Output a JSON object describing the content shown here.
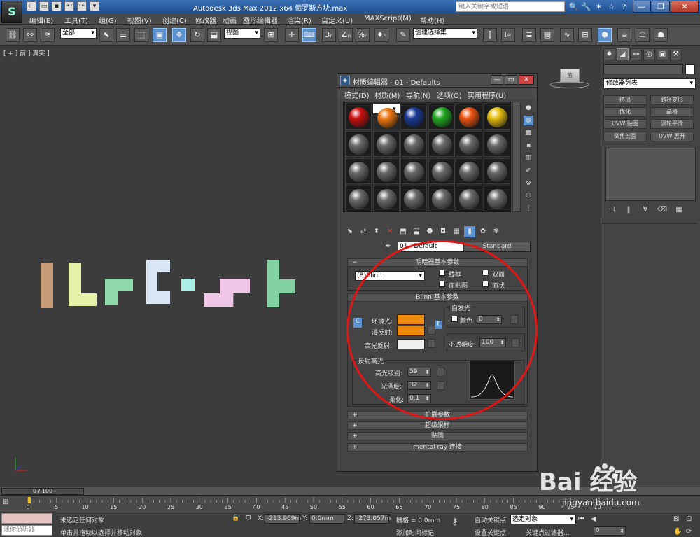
{
  "title_bar": {
    "logo": "S",
    "window_title": "Autodesk 3ds Max  2012 x64   俄罗斯方块.max",
    "search_placeholder": "键入关键字或短语",
    "title_icons": [
      "🔍",
      "🔧",
      "✶",
      "☆",
      "?"
    ],
    "controls": [
      "—",
      "❐",
      "✕"
    ]
  },
  "menu": [
    "编辑(E)",
    "工具(T)",
    "组(G)",
    "视图(V)",
    "创建(C)",
    "修改器",
    "动画",
    "图形编辑器",
    "渲染(R)",
    "自定义(U)",
    "MAXScript(M)",
    "帮助(H)"
  ],
  "toolbar": {
    "filter_select": "全部",
    "view_select": "视图",
    "selection_set": "创建选择集",
    "snap_labels": [
      "3ₙ",
      "∠ₙ",
      "%ₙ",
      "♦ₙ"
    ]
  },
  "viewport": {
    "label": "[ + ] 前 ] 真实 ]",
    "viewcube_label": "前",
    "blocks": [
      {
        "color": "#c49a77"
      },
      {
        "color": "#e6f0a6"
      },
      {
        "color": "#8ed8a9"
      },
      {
        "color": "#d9e6f5"
      },
      {
        "color": "#aaf0e6"
      },
      {
        "color": "#f0c6e6"
      },
      {
        "color": "#84d2a4"
      }
    ]
  },
  "material_editor": {
    "title": "材质编辑器 - 01 - Defaults",
    "menu": [
      "模式(D)",
      "材质(M)",
      "导航(N)",
      "选项(O)",
      "实用程序(U)"
    ],
    "sample_colors": [
      "#cc1111",
      "#ee7711",
      "#1a3a99",
      "#22aa22",
      "#ee5511",
      "#e8c012"
    ],
    "material_name": "01 - Default",
    "material_type": "Standard",
    "shader_rollout": "明暗器基本参数",
    "shader_type": "(B)Blinn",
    "shader_options": [
      "线框",
      "双面",
      "面贴图",
      "面状"
    ],
    "blinn_rollout": "Blinn 基本参数",
    "self_illum_group": "自发光",
    "self_illum_color_label": "颜色",
    "self_illum_value": "0",
    "ambient_label": "环境光:",
    "diffuse_label": "漫反射:",
    "specular_label": "高光反射:",
    "ambient_color": "#f08a0a",
    "diffuse_color": "#f08a0a",
    "specular_color": "#f0f0f0",
    "opacity_label": "不透明度:",
    "opacity_value": "100",
    "spec_group": "反射高光",
    "spec_level_label": "高光级别:",
    "spec_level_value": "59",
    "glossiness_label": "光泽度:",
    "glossiness_value": "32",
    "soften_label": "柔化:",
    "soften_value": "0.1",
    "lock_c": "C",
    "map_f": "F",
    "rollouts": [
      "扩展参数",
      "超级采样",
      "贴图",
      "mental ray 连接"
    ]
  },
  "command_panel": {
    "modifier_list": "修改器列表",
    "buttons": [
      "挤出",
      "路径变形",
      "优化",
      "晶格",
      "UVW 贴图",
      "涡轮平滑",
      "倒角剖面",
      "UVW 展开"
    ]
  },
  "timeline": {
    "frame": "0 / 100",
    "ticks": [
      "0",
      "5",
      "10",
      "15",
      "20",
      "25",
      "30",
      "35",
      "40",
      "45",
      "50",
      "55",
      "60",
      "65",
      "70",
      "75",
      "80",
      "85",
      "90",
      "95",
      "100"
    ]
  },
  "status": {
    "script_hint": "迷你侦听器",
    "selection": "未选定任何对象",
    "prompt": "单击并拖动以选择并移动对象",
    "x_label": "X:",
    "x_value": "-213.969m",
    "y_label": "Y:",
    "y_value": "0.0mm",
    "z_label": "Z:",
    "z_value": "-273.057m",
    "grid": "栅格 = 0.0mm",
    "add_time_tag": "添加时间标记",
    "auto_key": "自动关键点",
    "set_key": "设置关键点",
    "selected_obj": "选定对象",
    "key_filter": "关键点过滤器...",
    "frame_value": "0"
  },
  "watermark": {
    "brand": "Bai 经验",
    "url": "jingyan.baidu.com"
  }
}
